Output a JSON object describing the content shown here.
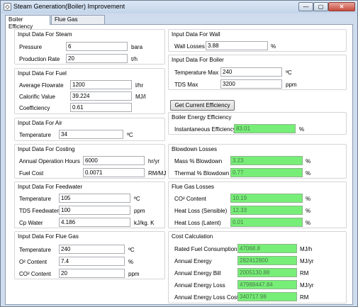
{
  "window": {
    "title": "Steam Generation(Boiler) Improvement",
    "min_glyph": "—",
    "max_glyph": "▢",
    "close_glyph": "✕",
    "icon_glyph": "◇"
  },
  "tabs": [
    {
      "label": "Boiler Efficiency",
      "active": true
    },
    {
      "label": "Flue Gas Recovery",
      "active": false
    }
  ],
  "left": {
    "steam": {
      "title": "Input Data For Steam",
      "pressure": {
        "label": "Pressure",
        "value": "6",
        "unit": "bara"
      },
      "production": {
        "label": "Production Rate",
        "value": "20",
        "unit": "t/h"
      }
    },
    "fuel": {
      "title": "Input Data For Fuel",
      "flowrate": {
        "label": "Average Flowrate",
        "value": "1200",
        "unit": "l/hr"
      },
      "calorific": {
        "label": "Calorific Value",
        "value": "39.224",
        "unit": "MJ/l"
      },
      "coefficiency": {
        "label": "Coefficiency",
        "value": "0.61"
      }
    },
    "air": {
      "title": "Input Data For Air",
      "temperature": {
        "label": "Temperature",
        "value": "34",
        "unit": "ºC"
      }
    },
    "costing": {
      "title": "Input Data For Costing",
      "hours": {
        "label": "Annual Operation Hours",
        "value": "6000",
        "unit": "hr/yr"
      },
      "fuelcost": {
        "label": "Fuel Cost",
        "value": "0.0071",
        "unit": "RM/MJ"
      }
    },
    "feedwater": {
      "title": "Input Data For Feedwater",
      "temperature": {
        "label": "Temperature",
        "value": "105",
        "unit": "ºC"
      },
      "tds": {
        "label": "TDS Feedwater",
        "value": "100",
        "unit": "ppm"
      },
      "cp": {
        "label": "Cp Water",
        "value": "4.186",
        "unit": "kJ/kg. K"
      }
    },
    "fluegas": {
      "title": "Input Data For Flue Gas",
      "temperature": {
        "label": "Temperature",
        "value": "240",
        "unit": "ºC"
      },
      "o2": {
        "label": "O² Content",
        "value": "7.4",
        "unit": "%"
      },
      "co2": {
        "label": "CO² Content",
        "value": "20",
        "unit": "ppm"
      }
    }
  },
  "right": {
    "wall": {
      "title": "Input Data For Wall",
      "losses": {
        "label": "Wall Losses",
        "value": "3.88",
        "unit": "%"
      }
    },
    "boiler": {
      "title": "Input Data For Boiler",
      "tmax": {
        "label": "Temperature Max",
        "value": "240",
        "unit": "ºC"
      },
      "tdsmax": {
        "label": "TDS Max",
        "value": "3200",
        "unit": "ppm"
      }
    },
    "get_button": "Get Current Efficiency",
    "efficiency": {
      "title": "Boiler Energy Efficiency",
      "instant": {
        "label": "Instantaneous Efficiency",
        "value": "83.01",
        "unit": "%"
      }
    },
    "blowdown": {
      "title": "Blowdown Losses",
      "mass": {
        "label": "Mass % Blowdown",
        "value": "3.23",
        "unit": "%"
      },
      "thermal": {
        "label": "Thermal % Blowdown",
        "value": "0.77",
        "unit": "%"
      }
    },
    "fluelosses": {
      "title": "Flue Gas Losses",
      "co2": {
        "label": "CO² Content",
        "value": "10.19",
        "unit": "%"
      },
      "sensible": {
        "label": "Heat Loss (Sensible)",
        "value": "12.33",
        "unit": "%"
      },
      "latent": {
        "label": "Heat Loss (Latent)",
        "value": "0.01",
        "unit": "%"
      }
    },
    "cost": {
      "title": "Cost Calculation",
      "rated": {
        "label": "Rated Fuel Consumption",
        "value": "47068.8",
        "unit": "MJ/h"
      },
      "energy": {
        "label": "Annual Energy",
        "value": "282412800",
        "unit": "MJ/yr"
      },
      "bill": {
        "label": "Annual Energy Bill",
        "value": "2005130.88",
        "unit": "RM"
      },
      "loss": {
        "label": "Annual Energy Loss",
        "value": "47988447.84",
        "unit": "MJ/yr"
      },
      "losscost": {
        "label": "Annual Energy Loss Cost",
        "value": "340717.98",
        "unit": "RM"
      }
    }
  },
  "colors": {
    "accent_green": "#77ee77",
    "window_frame": "#cfdced",
    "close_red": "#c74b3d"
  }
}
